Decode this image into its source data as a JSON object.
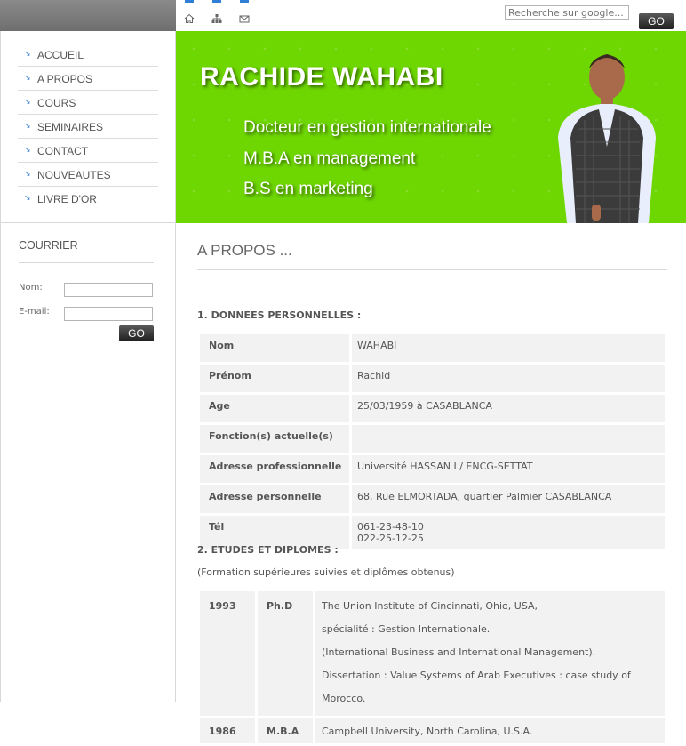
{
  "top": {
    "search_placeholder": "Recherche sur google...",
    "go_label": "GO",
    "icons": [
      "home-icon",
      "sitemap-icon",
      "mail-icon"
    ]
  },
  "nav": {
    "items": [
      {
        "label": "ACCUEIL"
      },
      {
        "label": "A PROPOS"
      },
      {
        "label": "COURS"
      },
      {
        "label": "SEMINAIRES"
      },
      {
        "label": "CONTACT"
      },
      {
        "label": "NOUVEAUTES"
      },
      {
        "label": "LIVRE D'OR"
      }
    ]
  },
  "courrier": {
    "title": "COURRIER",
    "name_label": "Nom:",
    "email_label": "E-mail:",
    "go_label": "GO"
  },
  "banner": {
    "name": "RACHIDE WAHABI",
    "lines": [
      "Docteur en gestion internationale",
      "M.B.A en management",
      "B.S en marketing"
    ],
    "color": "#6ed600"
  },
  "main": {
    "title": "A PROPOS ...",
    "personal": {
      "heading": "1. DONNEES PERSONNELLES :",
      "rows": [
        {
          "key": "Nom",
          "value": "WAHABI"
        },
        {
          "key": "Prénom",
          "value": "Rachid"
        },
        {
          "key": "Age",
          "value": "25/03/1959 à CASABLANCA"
        },
        {
          "key": "Fonction(s) actuelle(s)",
          "value": ""
        },
        {
          "key": "Adresse professionnelle",
          "value": "Université HASSAN I / ENCG-SETTAT"
        },
        {
          "key": "Adresse personnelle",
          "value": "68, Rue ELMORTADA, quartier Palmier CASABLANCA"
        },
        {
          "key": "Tél",
          "value": "061-23-48-10",
          "value2": "022-25-12-25"
        }
      ]
    },
    "etudes": {
      "heading": "2. ETUDES ET DIPLOMES :",
      "subheading": "(Formation supérieures suivies et diplômes obtenus)",
      "rows": [
        {
          "year": "1993",
          "degree": "Ph.D",
          "lines": [
            "The Union Institute of Cincinnati, Ohio, USA,",
            "spécialité : Gestion Internationale.",
            "(International Business and International Management).",
            "Dissertation : Value Systems of Arab Executives : case study of Morocco."
          ]
        },
        {
          "year": "1986",
          "degree": "M.B.A",
          "lines": [
            "Campbell University, North Carolina, U.S.A."
          ]
        }
      ]
    }
  }
}
